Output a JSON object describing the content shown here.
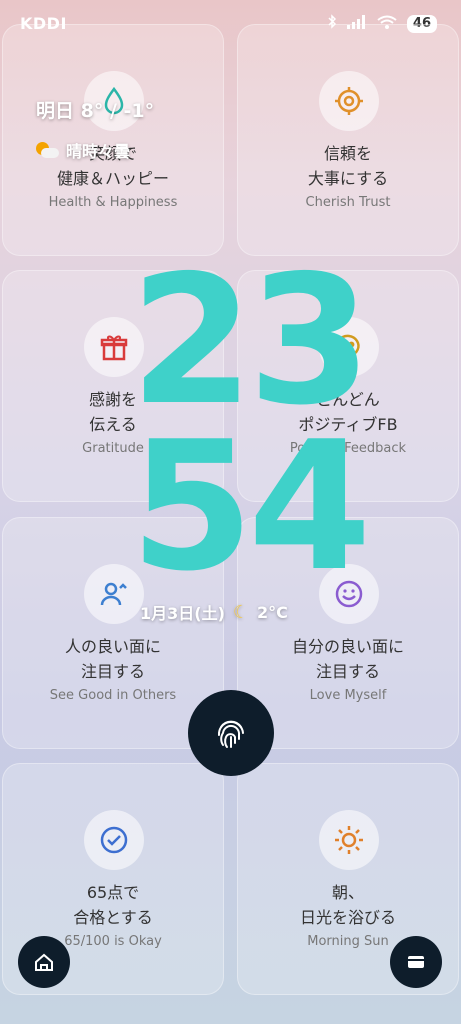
{
  "status_bar": {
    "carrier": "KDDI",
    "battery": "46"
  },
  "weather": {
    "temp": "明日 8° / -1°",
    "condition": "晴時々曇"
  },
  "clock": {
    "hours": "23",
    "minutes": "54"
  },
  "date": {
    "text": "1月3日(土)",
    "temp": "2°C"
  },
  "cards": [
    {
      "title": "笑顔で\n健康＆ハッピー",
      "subtitle": "Health & Happiness",
      "icon": "drop-icon",
      "color": "#2bb5a8"
    },
    {
      "title": "信頼を\n大事にする",
      "subtitle": "Cherish Trust",
      "icon": "target-icon",
      "color": "#e0902a"
    },
    {
      "title": "感謝を\n伝える",
      "subtitle": "Gratitude",
      "icon": "gift-icon",
      "color": "#d93b3b"
    },
    {
      "title": "どんどん\nポジティブFB",
      "subtitle": "Positive Feedback",
      "icon": "chat-heart-icon",
      "color": "#d19a1e"
    },
    {
      "title": "人の良い面に\n注目する",
      "subtitle": "See Good in Others",
      "icon": "person-icon",
      "color": "#3d7fd0"
    },
    {
      "title": "自分の良い面に\n注目する",
      "subtitle": "Love Myself",
      "icon": "smile-icon",
      "color": "#8a5cd0"
    },
    {
      "title": "65点で\n合格とする",
      "subtitle": "65/100 is Okay",
      "icon": "check-circle-icon",
      "color": "#3d6fd0"
    },
    {
      "title": "朝、\n日光を浴びる",
      "subtitle": "Morning Sun",
      "icon": "sun-icon",
      "color": "#e0802a"
    }
  ],
  "colors": {
    "clock": "#3fd1c9",
    "fab": "#0e1d2b"
  }
}
